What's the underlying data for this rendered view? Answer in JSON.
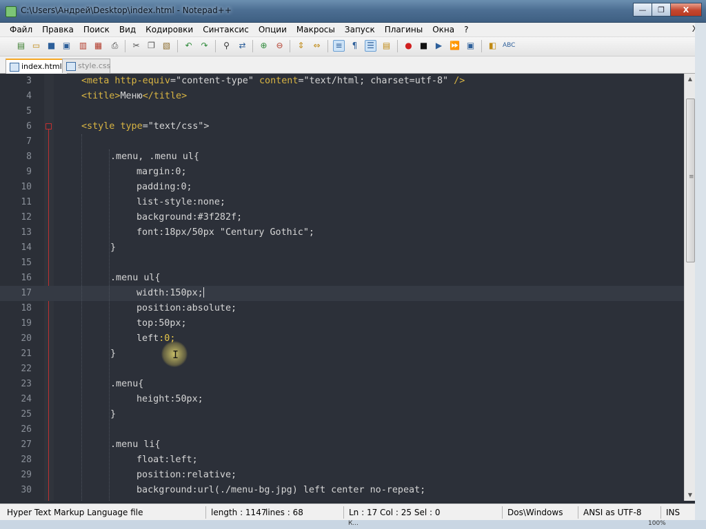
{
  "window": {
    "title": "C:\\Users\\Андрей\\Desktop\\index.html - Notepad++",
    "caption": {
      "minimize": "—",
      "maximize": "❐",
      "close": "X"
    }
  },
  "menubar": {
    "items": [
      "Файл",
      "Правка",
      "Поиск",
      "Вид",
      "Кодировки",
      "Синтаксис",
      "Опции",
      "Макросы",
      "Запуск",
      "Плагины",
      "Окна",
      "?"
    ],
    "close": "X"
  },
  "toolbar": {
    "icons": [
      "new-file-icon",
      "open-file-icon",
      "save-icon",
      "save-all-icon",
      "close-icon",
      "close-all-icon",
      "print-icon",
      "cut-icon",
      "copy-icon",
      "paste-icon",
      "undo-icon",
      "redo-icon",
      "find-icon",
      "replace-icon",
      "zoom-in-icon",
      "zoom-out-icon",
      "sync-vertical-icon",
      "sync-horizontal-icon",
      "word-wrap-icon",
      "show-all-chars-icon",
      "indent-guide-icon",
      "doc-map-icon",
      "record-macro-icon",
      "stop-macro-icon",
      "play-macro-icon",
      "run-macro-multiple-icon",
      "save-macro-icon",
      "launch-browser-icon",
      "spell-check-icon"
    ]
  },
  "tabs": [
    {
      "label": "index.html",
      "active": true
    },
    {
      "label": "style.css",
      "active": false
    }
  ],
  "editor": {
    "current_line": 17,
    "lines": [
      {
        "n": "3",
        "indent": 1,
        "segs": [
          [
            "tag",
            "<meta "
          ],
          [
            "attr",
            "http-equiv"
          ],
          [
            "str",
            "=\"content-type\" "
          ],
          [
            "attr",
            "content"
          ],
          [
            "str",
            "=\"text/html; charset=utf-8\" "
          ],
          [
            "tag",
            "/>"
          ]
        ]
      },
      {
        "n": "4",
        "indent": 1,
        "segs": [
          [
            "tag",
            "<title>"
          ],
          [
            "str",
            "Меню"
          ],
          [
            "tag",
            "</title>"
          ]
        ]
      },
      {
        "n": "5",
        "indent": 0,
        "segs": []
      },
      {
        "n": "6",
        "indent": 1,
        "segs": [
          [
            "tag",
            "<style "
          ],
          [
            "attr",
            "type"
          ],
          [
            "str",
            "=\"text/css\">"
          ]
        ]
      },
      {
        "n": "7",
        "indent": 0,
        "segs": []
      },
      {
        "n": "8",
        "indent": 2,
        "segs": [
          [
            "str",
            ".menu, .menu ul{"
          ]
        ]
      },
      {
        "n": "9",
        "indent": 3,
        "segs": [
          [
            "str",
            "margin:0;"
          ]
        ]
      },
      {
        "n": "10",
        "indent": 3,
        "segs": [
          [
            "str",
            "padding:0;"
          ]
        ]
      },
      {
        "n": "11",
        "indent": 3,
        "segs": [
          [
            "str",
            "list-style:none;"
          ]
        ]
      },
      {
        "n": "12",
        "indent": 3,
        "segs": [
          [
            "str",
            "background:#3f282f;"
          ]
        ]
      },
      {
        "n": "13",
        "indent": 3,
        "segs": [
          [
            "str",
            "font:18px/50px \"Century Gothic\";"
          ]
        ]
      },
      {
        "n": "14",
        "indent": 2,
        "segs": [
          [
            "str",
            "}"
          ]
        ]
      },
      {
        "n": "15",
        "indent": 0,
        "segs": []
      },
      {
        "n": "16",
        "indent": 2,
        "segs": [
          [
            "str",
            ".menu ul{"
          ]
        ]
      },
      {
        "n": "17",
        "indent": 3,
        "segs": [
          [
            "str",
            "width:150px;"
          ]
        ],
        "caret": true
      },
      {
        "n": "18",
        "indent": 3,
        "segs": [
          [
            "str",
            "position:absolute;"
          ]
        ]
      },
      {
        "n": "19",
        "indent": 3,
        "segs": [
          [
            "str",
            "top:50px;"
          ]
        ]
      },
      {
        "n": "20",
        "indent": 3,
        "segs": [
          [
            "str",
            "left"
          ],
          [
            "yel",
            ":0;"
          ]
        ]
      },
      {
        "n": "21",
        "indent": 2,
        "segs": [
          [
            "str",
            "}"
          ]
        ]
      },
      {
        "n": "22",
        "indent": 0,
        "segs": []
      },
      {
        "n": "23",
        "indent": 2,
        "segs": [
          [
            "str",
            ".menu{"
          ]
        ]
      },
      {
        "n": "24",
        "indent": 3,
        "segs": [
          [
            "str",
            "height:50px;"
          ]
        ]
      },
      {
        "n": "25",
        "indent": 2,
        "segs": [
          [
            "str",
            "}"
          ]
        ]
      },
      {
        "n": "26",
        "indent": 0,
        "segs": []
      },
      {
        "n": "27",
        "indent": 2,
        "segs": [
          [
            "str",
            ".menu li{"
          ]
        ]
      },
      {
        "n": "28",
        "indent": 3,
        "segs": [
          [
            "str",
            "float:left;"
          ]
        ]
      },
      {
        "n": "29",
        "indent": 3,
        "segs": [
          [
            "str",
            "position:relative;"
          ]
        ]
      },
      {
        "n": "30",
        "indent": 3,
        "segs": [
          [
            "str",
            "background:url(./menu-bg.jpg) left center no-repeat;"
          ]
        ]
      }
    ]
  },
  "scrollbar": {
    "up": "▲",
    "down": "▼",
    "grip": "≡"
  },
  "statusbar": {
    "filetype": "Hyper Text Markup Language file",
    "length": "length : 1147",
    "lines": "lines : 68",
    "position": "Ln : 17    Col : 25    Sel : 0",
    "eol": "Dos\\Windows",
    "encoding": "ANSI as UTF-8",
    "mode": "INS"
  },
  "taskbar": {
    "partial_a": "К...",
    "partial_b": "100%"
  }
}
